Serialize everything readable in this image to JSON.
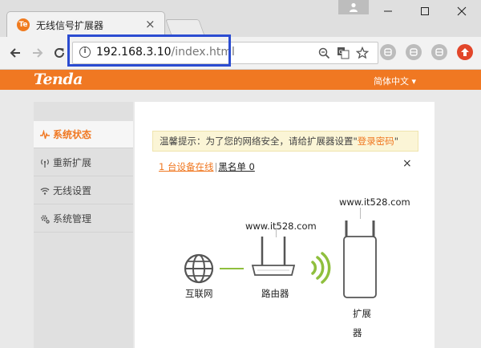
{
  "browser": {
    "tab_title": "无线信号扩展器",
    "tab_favicon_text": "Te",
    "url_host": "192.168.3.10",
    "url_path": "/index.html",
    "highlight_color": "#2b4cd1"
  },
  "icons": {
    "back": "back-arrow-icon",
    "forward": "forward-arrow-icon",
    "reload": "reload-icon",
    "info": "info-icon",
    "zoom": "zoom-out-icon",
    "translate": "translate-icon",
    "bookmark": "star-icon",
    "update": "update-arrow-icon"
  },
  "header": {
    "logo": "Tenda",
    "language": "简体中文",
    "brand_color": "#f07822"
  },
  "sidebar": {
    "items": [
      {
        "label": "系统状态",
        "icon": "pulse-icon",
        "active": true
      },
      {
        "label": "重新扩展",
        "icon": "signal-icon",
        "active": false
      },
      {
        "label": "无线设置",
        "icon": "wifi-icon",
        "active": false
      },
      {
        "label": "系统管理",
        "icon": "gear-icon",
        "active": false
      }
    ]
  },
  "notice": {
    "prefix": "温馨提示：为了您的网络安全，请给扩展器设置",
    "link": "登录密码"
  },
  "devices": {
    "online": "1 台设备在线",
    "separator": "|",
    "blacklist": "黑名单 0"
  },
  "diagram": {
    "internet_label": "互联网",
    "router_label": "路由器",
    "router_ssid": "www.it528.com",
    "extender_label_1": "扩展",
    "extender_label_2": "器",
    "extender_ssid": "www.it528.com"
  }
}
